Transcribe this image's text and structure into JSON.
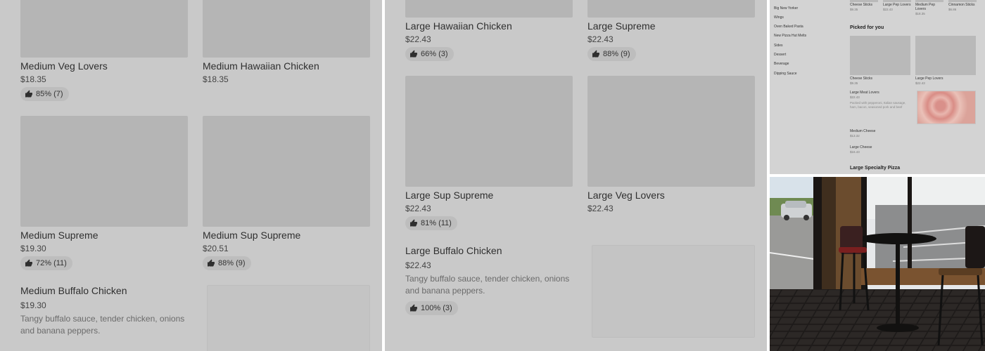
{
  "colors": {
    "overlay": "#c9c9c9",
    "image_placeholder": "#b5b5b5",
    "badge": "#bdbdbd",
    "text": "#2f2f2f"
  },
  "left_panel": {
    "items": [
      {
        "name": "Medium Veg Lovers",
        "price": "$18.35",
        "rating": "85% (7)"
      },
      {
        "name": "Medium Hawaiian Chicken",
        "price": "$18.35"
      },
      {
        "name": "Medium Supreme",
        "price": "$19.30",
        "rating": "72% (11)"
      },
      {
        "name": "Medium Sup Supreme",
        "price": "$20.51",
        "rating": "88% (9)"
      },
      {
        "name": "Medium Buffalo Chicken",
        "price": "$19.30",
        "description": "Tangy buffalo sauce, tender chicken, onions and banana peppers."
      }
    ]
  },
  "middle_panel": {
    "items": [
      {
        "name": "Large Hawaiian Chicken",
        "price": "$22.43",
        "rating": "66% (3)"
      },
      {
        "name": "Large Supreme",
        "price": "$22.43",
        "rating": "88% (9)"
      },
      {
        "name": "Large Sup Supreme",
        "price": "$22.43",
        "rating": "81% (11)"
      },
      {
        "name": "Large Veg Lovers",
        "price": "$22.43"
      },
      {
        "name": "Large Buffalo Chicken",
        "price": "$22.43",
        "description": "Tangy buffalo sauce, tender chicken, onions and banana peppers.",
        "rating": "100% (3)"
      }
    ]
  },
  "mini_menu": {
    "sidebar": [
      "Big New Yorker",
      "Wings",
      "Oven Baked Pasta",
      "New Pizza Hut Melts",
      "Sides",
      "Dessert",
      "Beverage",
      "Dipping Sauce"
    ],
    "top_row": [
      {
        "name": "Cheese Sticks",
        "price": "$9.35"
      },
      {
        "name": "Large Pep Lovers",
        "price": "$22.43"
      },
      {
        "name": "Medium Pep Lovers",
        "price": "$18.35"
      },
      {
        "name": "Cinnamon Sticks",
        "price": "$6.86"
      }
    ],
    "picked_heading": "Picked for you",
    "picked": [
      {
        "name": "Cheese Sticks",
        "price": "$9.35"
      },
      {
        "name": "Large Pep Lovers",
        "price": "$22.43"
      }
    ],
    "list": [
      {
        "name": "Large Meat Lovers",
        "price": "$22.43",
        "description": "Packed with pepperoni, Italian sausage, ham, bacon, seasoned pork and beef"
      },
      {
        "name": "Medium Cheese",
        "price": "$13.32"
      },
      {
        "name": "Large Cheese",
        "price": "$16.43"
      }
    ],
    "section_heading": "Large Specialty Pizza"
  }
}
